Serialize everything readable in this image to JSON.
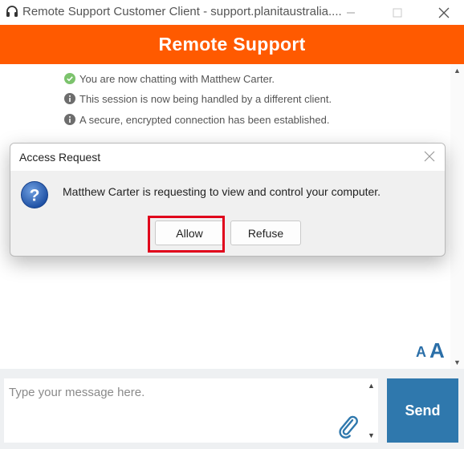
{
  "window": {
    "title": "Remote Support Customer Client - support.planitaustralia....",
    "app_icon": "headset-icon"
  },
  "header": {
    "title": "Remote Support",
    "color": "#ff5a00"
  },
  "chat": {
    "messages": [
      {
        "icon": "check-circle-icon",
        "text": "You are now chatting with Matthew Carter."
      },
      {
        "icon": "info-icon",
        "text": "This session is now being handled by a different client."
      },
      {
        "icon": "info-icon",
        "text": "A secure, encrypted connection has been established."
      }
    ],
    "font_size_small": "A",
    "font_size_large": "A"
  },
  "dialog": {
    "title": "Access Request",
    "icon": "question-icon",
    "message": "Matthew Carter is requesting to view and control your computer.",
    "allow_label": "Allow",
    "refuse_label": "Refuse",
    "highlight_color": "#e0001b"
  },
  "input": {
    "placeholder": "Type your message here.",
    "value": "",
    "send_label": "Send",
    "send_color": "#2f78ad"
  }
}
